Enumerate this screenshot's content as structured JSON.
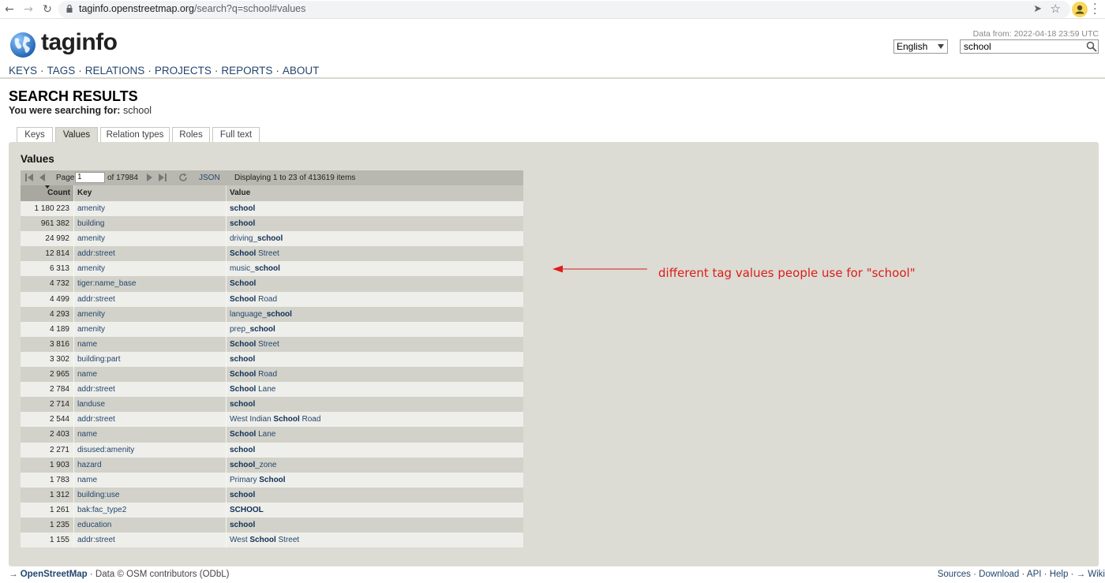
{
  "browser": {
    "url_host": "taginfo.openstreetmap.org",
    "url_path": "/search?q=school#values"
  },
  "header": {
    "logo_text": "taginfo",
    "data_from": "Data from: 2022-04-18 23:59 UTC",
    "language": "English",
    "search_value": "school",
    "nav": [
      "KEYS",
      "TAGS",
      "RELATIONS",
      "PROJECTS",
      "REPORTS",
      "ABOUT"
    ]
  },
  "page": {
    "title": "SEARCH RESULTS",
    "searching_label": "You were searching for:",
    "searching_term": " school",
    "tabs": [
      "Keys",
      "Values",
      "Relation types",
      "Roles",
      "Full text"
    ],
    "active_tab": "Values",
    "panel_title": "Values"
  },
  "pager": {
    "page_label": "Page",
    "page_value": "1",
    "of_label": "of 17984",
    "json_label": "JSON",
    "display_text": "Displaying 1 to 23 of 413619 items"
  },
  "table": {
    "headers": [
      "Count",
      "Key",
      "Value"
    ],
    "rows": [
      {
        "count": "1 180 223",
        "key": "amenity",
        "value": [
          [
            "school",
            true
          ]
        ]
      },
      {
        "count": "961 382",
        "key": "building",
        "value": [
          [
            "school",
            true
          ]
        ]
      },
      {
        "count": "24 992",
        "key": "amenity",
        "value": [
          [
            "driving_",
            false
          ],
          [
            "school",
            true
          ]
        ]
      },
      {
        "count": "12 814",
        "key": "addr:street",
        "value": [
          [
            "School",
            true
          ],
          [
            " Street",
            false
          ]
        ]
      },
      {
        "count": "6 313",
        "key": "amenity",
        "value": [
          [
            "music_",
            false
          ],
          [
            "school",
            true
          ]
        ]
      },
      {
        "count": "4 732",
        "key": "tiger:name_base",
        "value": [
          [
            "School",
            true
          ]
        ]
      },
      {
        "count": "4 499",
        "key": "addr:street",
        "value": [
          [
            "School",
            true
          ],
          [
            " Road",
            false
          ]
        ]
      },
      {
        "count": "4 293",
        "key": "amenity",
        "value": [
          [
            "language_",
            false
          ],
          [
            "school",
            true
          ]
        ]
      },
      {
        "count": "4 189",
        "key": "amenity",
        "value": [
          [
            "prep_",
            false
          ],
          [
            "school",
            true
          ]
        ]
      },
      {
        "count": "3 816",
        "key": "name",
        "value": [
          [
            "School",
            true
          ],
          [
            " Street",
            false
          ]
        ]
      },
      {
        "count": "3 302",
        "key": "building:part",
        "value": [
          [
            "school",
            true
          ]
        ]
      },
      {
        "count": "2 965",
        "key": "name",
        "value": [
          [
            "School",
            true
          ],
          [
            " Road",
            false
          ]
        ]
      },
      {
        "count": "2 784",
        "key": "addr:street",
        "value": [
          [
            "School",
            true
          ],
          [
            " Lane",
            false
          ]
        ]
      },
      {
        "count": "2 714",
        "key": "landuse",
        "value": [
          [
            "school",
            true
          ]
        ]
      },
      {
        "count": "2 544",
        "key": "addr:street",
        "value": [
          [
            "West Indian ",
            false
          ],
          [
            "School",
            true
          ],
          [
            " Road",
            false
          ]
        ]
      },
      {
        "count": "2 403",
        "key": "name",
        "value": [
          [
            "School",
            true
          ],
          [
            " Lane",
            false
          ]
        ]
      },
      {
        "count": "2 271",
        "key": "disused:amenity",
        "value": [
          [
            "school",
            true
          ]
        ]
      },
      {
        "count": "1 903",
        "key": "hazard",
        "value": [
          [
            "school",
            true
          ],
          [
            "_zone",
            false
          ]
        ]
      },
      {
        "count": "1 783",
        "key": "name",
        "value": [
          [
            "Primary ",
            false
          ],
          [
            "School",
            true
          ]
        ]
      },
      {
        "count": "1 312",
        "key": "building:use",
        "value": [
          [
            "school",
            true
          ]
        ]
      },
      {
        "count": "1 261",
        "key": "bak:fac_type2",
        "value": [
          [
            "SCHOOL",
            true
          ]
        ]
      },
      {
        "count": "1 235",
        "key": "education",
        "value": [
          [
            "school",
            true
          ]
        ]
      },
      {
        "count": "1 155",
        "key": "addr:street",
        "value": [
          [
            "West ",
            false
          ],
          [
            "School",
            true
          ],
          [
            " Street",
            false
          ]
        ]
      }
    ]
  },
  "annotation": {
    "text": "different tag values people use for \"school\"",
    "color": "#dd1c1c"
  },
  "footer": {
    "arrow": "→ ",
    "osm_link": "OpenStreetMap",
    "data_text": " · Data © OSM contributors (ODbL)",
    "right_links": [
      "Sources",
      "Download",
      "API",
      "Help",
      "→ Wiki"
    ]
  }
}
